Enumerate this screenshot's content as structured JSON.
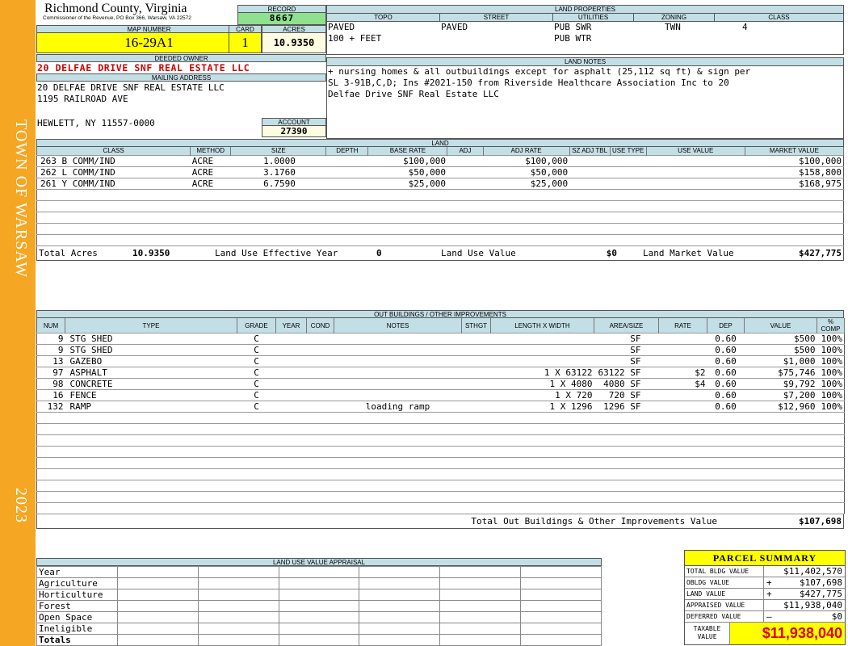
{
  "sidebar": {
    "town": "TOWN OF WARSAW",
    "year": "2023"
  },
  "header": {
    "county": "Richmond County, Virginia",
    "commissioner": "Commissioner of the Revenue, PO Box 366, Warsaw, VA 22572",
    "record_label": "RECORD",
    "record": "8667",
    "map_number_label": "MAP NUMBER",
    "map_number": "16-29A1",
    "card_label": "CARD",
    "card": "1",
    "acres_label": "ACRES",
    "acres": "10.9350"
  },
  "owner": {
    "deeded_label": "DEEDED OWNER",
    "deeded_owner": "20 DELFAE DRIVE SNF REAL ESTATE LLC",
    "mailing_label": "MAILING ADDRESS",
    "mailing_line1": "20 DELFAE DRIVE SNF REAL ESTATE LLC",
    "mailing_line2": "1195 RAILROAD AVE",
    "mailing_line3": "HEWLETT, NY 11557-0000",
    "account_label": "ACCOUNT",
    "account": "27390"
  },
  "land_properties": {
    "title": "LAND PROPERTIES",
    "headers": [
      "TOPO",
      "STREET",
      "UTILITIES",
      "ZONING",
      "CLASS"
    ],
    "topo": [
      "PAVED",
      "100 + FEET"
    ],
    "street": [
      "PAVED",
      ""
    ],
    "utilities": [
      "PUB SWR",
      "PUB WTR"
    ],
    "zoning": "TWN",
    "class": "4"
  },
  "land_notes": {
    "title": "LAND NOTES",
    "lines": [
      "+ nursing homes & all outbuildings except for asphalt (25,112 sq ft) & sign per",
      "SL 3-91B,C,D;  Ins #2021-150 from Riverside Healthcare Association Inc to 20",
      "Delfae Drive SNF Real Estate LLC"
    ]
  },
  "land": {
    "title": "LAND",
    "headers": [
      "CLASS",
      "METHOD",
      "SIZE",
      "DEPTH",
      "BASE RATE",
      "ADJ",
      "ADJ RATE",
      "SZ ADJ TBL",
      "USE TYPE",
      "USE VALUE",
      "MARKET VALUE"
    ],
    "rows": [
      [
        "263 B COMM/IND",
        "ACRE",
        "1.0000",
        "",
        "$100,000",
        "",
        "$100,000",
        "",
        "",
        "",
        "$100,000"
      ],
      [
        "262 L COMM/IND",
        "ACRE",
        "3.1760",
        "",
        "$50,000",
        "",
        "$50,000",
        "",
        "",
        "",
        "$158,800"
      ],
      [
        "261 Y COMM/IND",
        "ACRE",
        "6.7590",
        "",
        "$25,000",
        "",
        "$25,000",
        "",
        "",
        "",
        "$168,975"
      ]
    ],
    "total_acres_label": "Total Acres",
    "total_acres": "10.9350",
    "effective_year_label": "Land Use Effective Year",
    "effective_year": "0",
    "use_value_label": "Land Use Value",
    "use_value": "$0",
    "market_value_label": "Land Market Value",
    "market_value": "$427,775"
  },
  "outbuildings": {
    "title": "OUT BUILDINGS / OTHER IMPROVEMENTS",
    "headers": [
      "NUM",
      "TYPE",
      "GRADE",
      "YEAR",
      "COND",
      "NOTES",
      "STHGT",
      "LENGTH X WIDTH",
      "AREA/SIZE",
      "RATE",
      "DEP",
      "VALUE",
      "% COMP"
    ],
    "rows": [
      [
        "9",
        "STG SHED",
        "C",
        "",
        "",
        "",
        "",
        "",
        "SF",
        "",
        "0.60",
        "$500",
        "100%"
      ],
      [
        "9",
        "STG SHED",
        "C",
        "",
        "",
        "",
        "",
        "",
        "SF",
        "",
        "0.60",
        "$500",
        "100%"
      ],
      [
        "13",
        "GAZEBO",
        "C",
        "",
        "",
        "",
        "",
        "",
        "SF",
        "",
        "0.60",
        "$1,000",
        "100%"
      ],
      [
        "97",
        "ASPHALT",
        "C",
        "",
        "",
        "",
        "",
        "1 X 63122",
        "63122 SF",
        "$2",
        "0.60",
        "$75,746",
        "100%"
      ],
      [
        "98",
        "CONCRETE",
        "C",
        "",
        "",
        "",
        "",
        "1 X 4080",
        "4080 SF",
        "$4",
        "0.60",
        "$9,792",
        "100%"
      ],
      [
        "16",
        "FENCE",
        "C",
        "",
        "",
        "",
        "",
        "1 X 720",
        "720 SF",
        "",
        "0.60",
        "$7,200",
        "100%"
      ],
      [
        "132",
        "RAMP",
        "C",
        "",
        "",
        "loading ramp",
        "",
        "1 X 1296",
        "1296 SF",
        "",
        "0.60",
        "$12,960",
        "100%"
      ]
    ],
    "total_label": "Total Out Buildings & Other Improvements Value",
    "total": "$107,698"
  },
  "land_use_appraisal": {
    "title": "LAND USE VALUE APPRAISAL",
    "rows": [
      "Year",
      "Agriculture",
      "Horticulture",
      "Forest",
      "Open Space",
      "Ineligible",
      "Totals"
    ]
  },
  "parcel_summary": {
    "title": "PARCEL SUMMARY",
    "rows": [
      {
        "label": "TOTAL BLDG VALUE",
        "sign": "",
        "value": "$11,402,570"
      },
      {
        "label": "OBLDG VALUE",
        "sign": "+",
        "value": "$107,698"
      },
      {
        "label": "LAND VALUE",
        "sign": "+",
        "value": "$427,775"
      },
      {
        "label": "APPRAISED VALUE",
        "sign": "",
        "value": "$11,938,040"
      },
      {
        "label": "DEFERRED VALUE",
        "sign": "–",
        "value": "$0"
      }
    ],
    "taxable_label": "TAXABLE VALUE",
    "taxable_value": "$11,938,040"
  },
  "colors": {
    "sidebar": "#f5a623",
    "header_band": "#c3dfe6",
    "highlight": "#ffff00",
    "record_green": "#8fe08f",
    "owner_red": "#cc0000"
  }
}
